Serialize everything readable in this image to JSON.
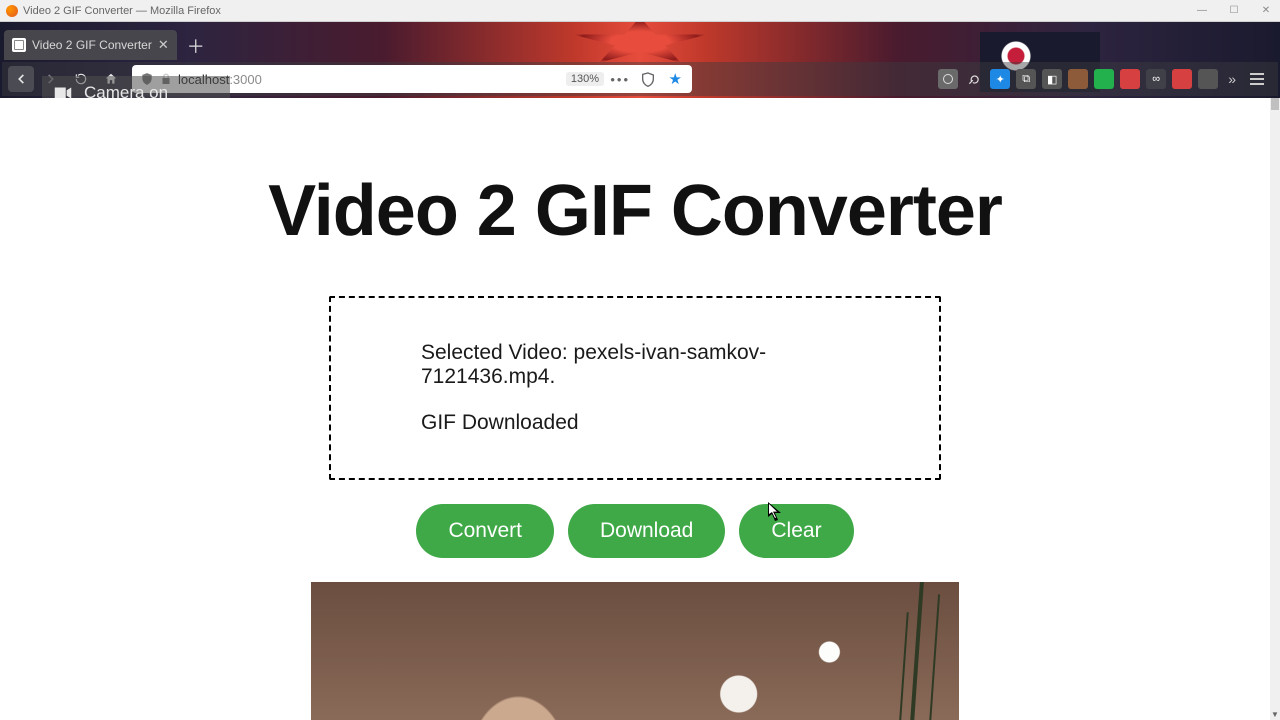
{
  "window": {
    "title": "Video 2 GIF Converter — Mozilla Firefox"
  },
  "tab": {
    "title": "Video 2 GIF Converter"
  },
  "url": {
    "host": "localhost",
    "port": ":3000"
  },
  "zoom": "130%",
  "camera_toast": "Camera on",
  "page": {
    "heading": "Video 2 GIF Converter",
    "selected_line": "Selected Video: pexels-ivan-samkov-7121436.mp4.",
    "status_line": "GIF Downloaded",
    "buttons": {
      "convert": "Convert",
      "download": "Download",
      "clear": "Clear"
    }
  },
  "ext_colors": [
    "#6a6a6a",
    "#6a6a6a",
    "#1e88e5",
    "#6a6a6a",
    "#6a6a6a",
    "#8d5a3a",
    "#22b14c",
    "#d64040",
    "#d64040",
    "#404048",
    "#d64040",
    "#555"
  ]
}
